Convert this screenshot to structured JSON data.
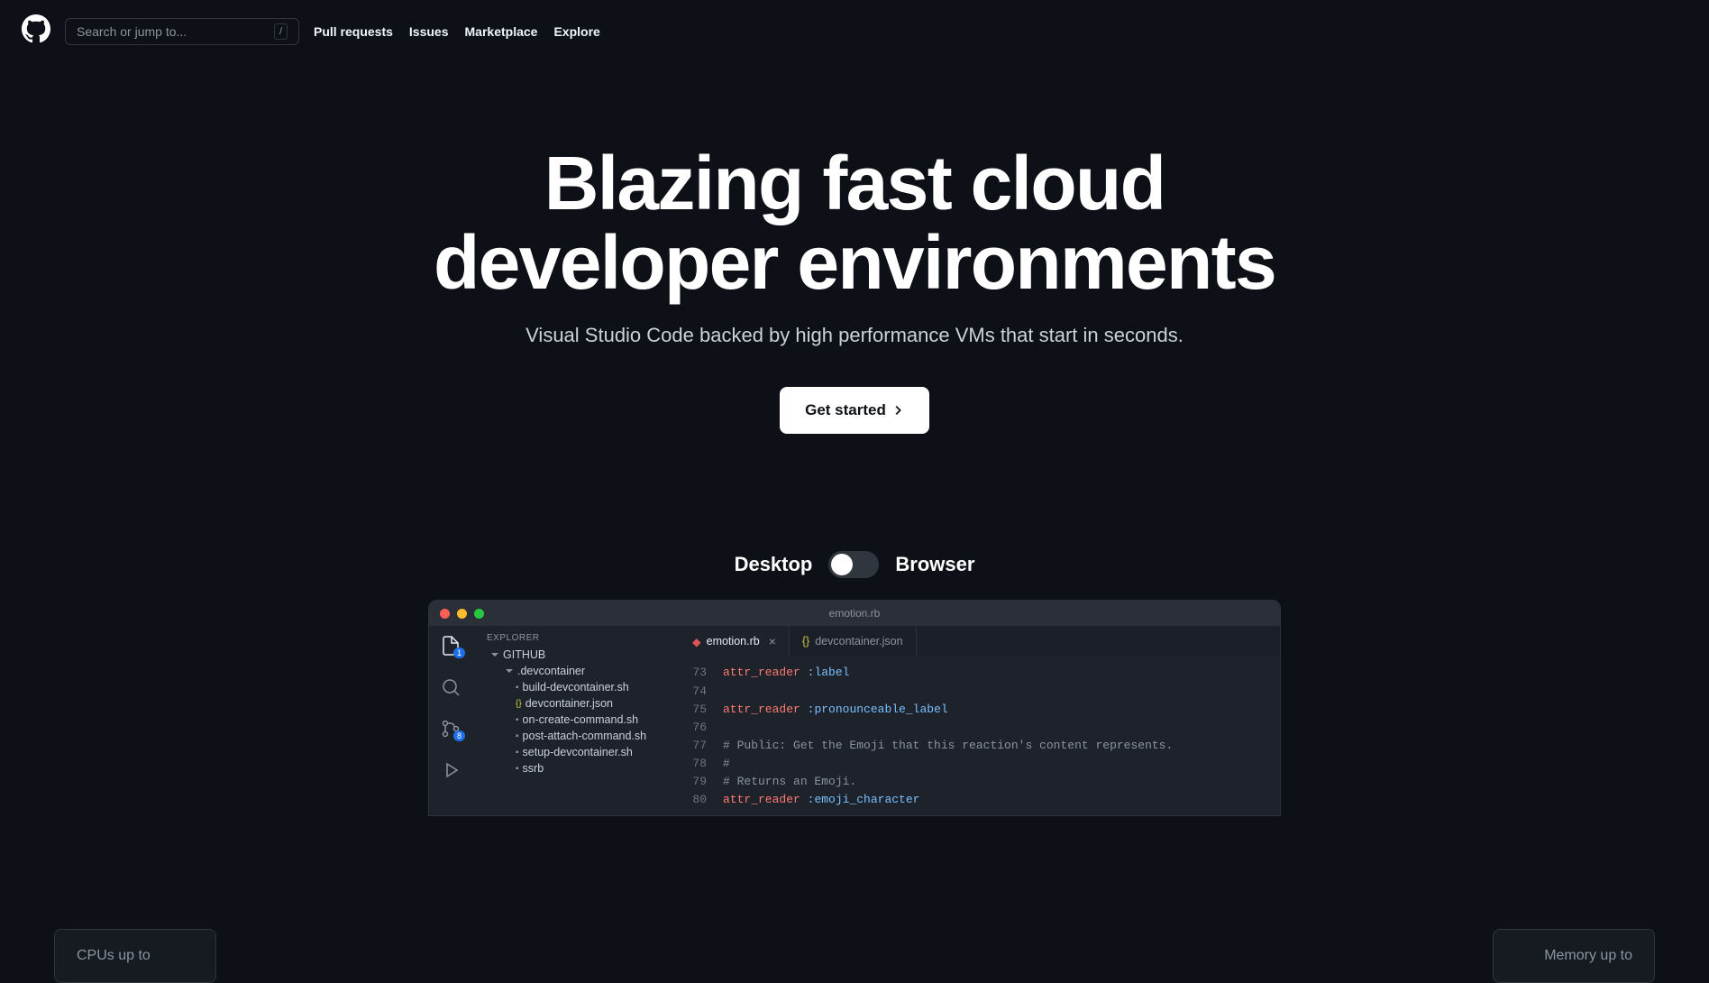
{
  "header": {
    "search_placeholder": "Search or jump to...",
    "search_key": "/",
    "nav": [
      "Pull requests",
      "Issues",
      "Marketplace",
      "Explore"
    ]
  },
  "hero": {
    "title_line1": "Blazing fast cloud",
    "title_line2": "developer environments",
    "subtitle": "Visual Studio Code backed by high performance VMs that start in seconds.",
    "cta": "Get started"
  },
  "toggle": {
    "left": "Desktop",
    "right": "Browser"
  },
  "editor": {
    "title": "emotion.rb",
    "sidebar_title": "EXPLORER",
    "activity_badges": {
      "files": "1",
      "scm": "8"
    },
    "tree": {
      "root": "GITHUB",
      "folder": ".devcontainer",
      "files": [
        "build-devcontainer.sh",
        "devcontainer.json",
        "on-create-command.sh",
        "post-attach-command.sh",
        "setup-devcontainer.sh",
        "ssrb"
      ]
    },
    "tabs": [
      {
        "label": "emotion.rb",
        "icon": "rb",
        "active": true,
        "closable": true
      },
      {
        "label": "devcontainer.json",
        "icon": "js",
        "active": false,
        "closable": false
      }
    ],
    "code": [
      {
        "num": "73",
        "tokens": [
          [
            "key",
            "attr_reader"
          ],
          [
            "txt",
            " "
          ],
          [
            "sym",
            ":label"
          ]
        ]
      },
      {
        "num": "74",
        "tokens": []
      },
      {
        "num": "75",
        "tokens": [
          [
            "key",
            "attr_reader"
          ],
          [
            "txt",
            " "
          ],
          [
            "sym",
            ":pronounceable_label"
          ]
        ]
      },
      {
        "num": "76",
        "tokens": []
      },
      {
        "num": "77",
        "tokens": [
          [
            "comment",
            "# Public: Get the Emoji that this reaction's content represents."
          ]
        ]
      },
      {
        "num": "78",
        "tokens": [
          [
            "comment",
            "#"
          ]
        ]
      },
      {
        "num": "79",
        "tokens": [
          [
            "comment",
            "# Returns an Emoji."
          ]
        ]
      },
      {
        "num": "80",
        "tokens": [
          [
            "key",
            "attr_reader"
          ],
          [
            "txt",
            " "
          ],
          [
            "sym",
            ":emoji_character"
          ]
        ]
      }
    ]
  },
  "bg_cards": {
    "left": "CPUs up to",
    "right": "Memory up to"
  }
}
